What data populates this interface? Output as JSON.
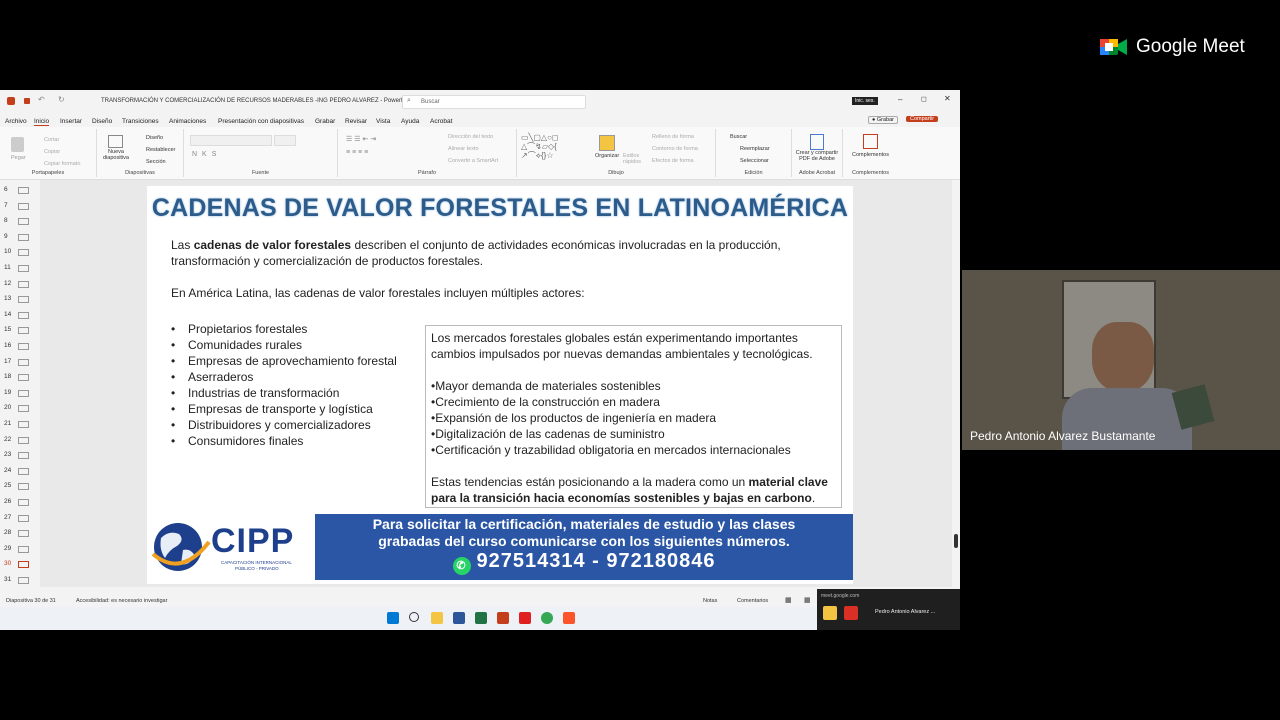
{
  "meet": {
    "brand": "Google Meet",
    "participant_name": "Pedro Antonio Alvarez Bustamante"
  },
  "ppt": {
    "window_title": "TRANSFORMACIÓN Y COMERCIALIZACIÓN DE RECURSOS MADERABLES -ING PEDRO ALVAREZ - PowerP...",
    "search_placeholder": "Buscar",
    "signin": "Inic. ses.",
    "menu": [
      "Archivo",
      "Inicio",
      "Insertar",
      "Diseño",
      "Transiciones",
      "Animaciones",
      "Presentación con diapositivas",
      "Grabar",
      "Revisar",
      "Vista",
      "Ayuda",
      "Acrobat"
    ],
    "grabar_button": "Grabar",
    "share_button": "Compartir",
    "ribbon": {
      "clipboard": {
        "pegar": "Pegar",
        "cortar": "Cortar",
        "copiar": "Copiar",
        "copiar_formato": "Copiar formato",
        "label": "Portapapeles"
      },
      "slides": {
        "nueva": "Nueva diapositiva",
        "diseno": "Diseño",
        "restablecer": "Restablecer",
        "seccion": "Sección",
        "label": "Diapositivas"
      },
      "font": {
        "label": "Fuente"
      },
      "paragraph": {
        "direccion": "Dirección del texto",
        "alinear": "Alinear texto",
        "smartart": "Convertir a SmartArt",
        "label": "Párrafo"
      },
      "drawing": {
        "organizar": "Organizar",
        "estilos": "Estilos rápidos",
        "relleno": "Relleno de forma",
        "contorno": "Contorno de forma",
        "efectos": "Efectos de forma",
        "label": "Dibujo"
      },
      "editing": {
        "buscar": "Buscar",
        "reemplazar": "Reemplazar",
        "seleccionar": "Seleccionar",
        "label": "Edición"
      },
      "adobe": {
        "crear": "Crear y compartir PDF de Adobe",
        "label": "Adobe Acrobat"
      },
      "complementos": {
        "btn": "Complementos",
        "label": "Complementos"
      }
    },
    "slide_numbers": [
      "6",
      "7",
      "8",
      "9",
      "10",
      "11",
      "12",
      "13",
      "14",
      "15",
      "16",
      "17",
      "18",
      "19",
      "20",
      "21",
      "22",
      "23",
      "24",
      "25",
      "26",
      "27",
      "28",
      "29",
      "30",
      "31"
    ],
    "status": {
      "slide": "Diapositiva 30 de 31",
      "accessibility": "Accesibilidad: es necesario investigar",
      "notes": "Notas",
      "comments": "Comentarios"
    }
  },
  "slide": {
    "title": "CADENAS DE VALOR FORESTALES EN LATINOAMÉRICA",
    "p1_pre": "Las ",
    "p1_bold": "cadenas de valor forestales",
    "p1_post": " describen el conjunto de actividades económicas involucradas en la producción,",
    "p1_line2": "transformación y comercialización de productos forestales.",
    "p2": "En América Latina, las cadenas de valor forestales incluyen múltiples actores:",
    "actors": [
      "Propietarios forestales",
      "Comunidades rurales",
      "Empresas de aprovechamiento forestal",
      "Aserraderos",
      "Industrias de transformación",
      "Empresas de transporte y logística",
      "Distribuidores y comercializadores",
      "Consumidores finales"
    ],
    "box_intro1": "Los mercados forestales globales están experimentando importantes",
    "box_intro2": "cambios impulsados por nuevas demandas ambientales y tecnológicas.",
    "trends": [
      "•Mayor demanda de materiales sostenibles",
      "•Crecimiento de la construcción en madera",
      "•Expansión de los productos de ingeniería en madera",
      "•Digitalización de las cadenas de suministro",
      "•Certificación y trazabilidad obligatoria en mercados internacionales"
    ],
    "box_end_pre": "Estas tendencias están posicionando a la madera como un ",
    "box_end_bold1": "material clave",
    "box_end_bold2": "para la transición hacia economías sostenibles y bajas en carbono",
    "box_end_post": ".",
    "banner_logo": "CIPP",
    "banner_logo_sub1": "CAPACITACIÓN INTERNACIONAL",
    "banner_logo_sub2": "PÚBLICO - PRIVADO",
    "banner_line1": "Para solicitar la certificación, materiales de estudio y las clases",
    "banner_line2": "grabadas del curso comunicarse con los siguientes números.",
    "banner_phones": "927514314 - 972180846"
  },
  "popup": {
    "url": "meet.google.com",
    "tab": "Pedro Antonio Alvarez ..."
  },
  "colors": {
    "title": "#2e5c8a",
    "banner": "#2b56a5",
    "whatsapp": "#25d366",
    "share": "#c43e1c"
  }
}
